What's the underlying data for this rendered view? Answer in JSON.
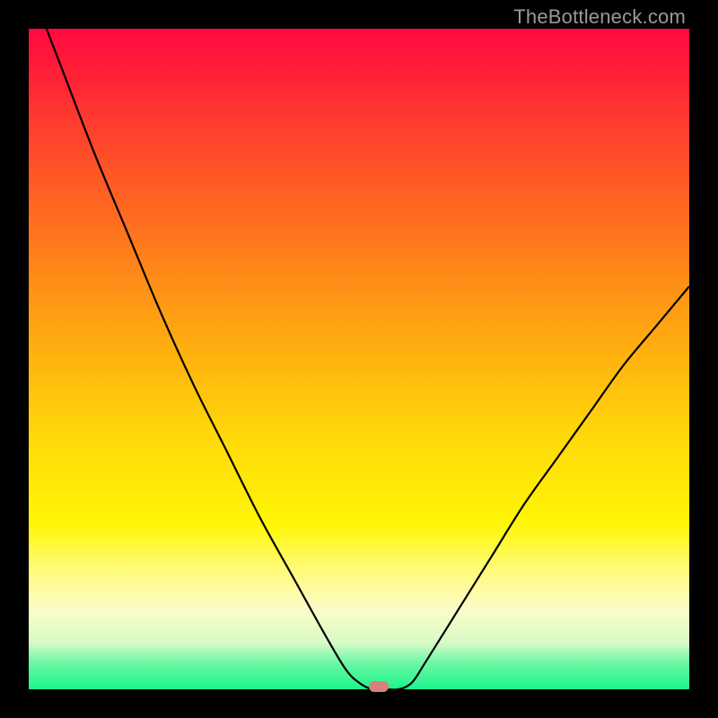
{
  "watermark": "TheBottleneck.com",
  "colors": {
    "frame": "#000000",
    "curve_stroke": "#000000",
    "marker": "#d88176",
    "gradient_stops": [
      {
        "offset": 0.0,
        "color": "#ff0a40"
      },
      {
        "offset": 0.05,
        "color": "#ff1938"
      },
      {
        "offset": 0.15,
        "color": "#ff3f2d"
      },
      {
        "offset": 0.28,
        "color": "#ff6a20"
      },
      {
        "offset": 0.45,
        "color": "#ffa412"
      },
      {
        "offset": 0.62,
        "color": "#ffd909"
      },
      {
        "offset": 0.75,
        "color": "#fff606"
      },
      {
        "offset": 0.82,
        "color": "#fffb7c"
      },
      {
        "offset": 0.88,
        "color": "#fcfcc8"
      },
      {
        "offset": 0.93,
        "color": "#d7fbc5"
      },
      {
        "offset": 0.96,
        "color": "#6bf7a4"
      },
      {
        "offset": 1.0,
        "color": "#1df58c"
      }
    ]
  },
  "chart_data": {
    "type": "line",
    "title": "",
    "xlabel": "",
    "ylabel": "",
    "xlim": [
      0,
      100
    ],
    "ylim": [
      0,
      100
    ],
    "grid": false,
    "series": [
      {
        "name": "bottleneck-curve",
        "x": [
          0,
          5,
          10,
          15,
          20,
          25,
          30,
          35,
          40,
          45,
          48,
          50,
          52,
          54,
          56,
          58,
          60,
          65,
          70,
          75,
          80,
          85,
          90,
          95,
          100
        ],
        "y": [
          107,
          94,
          81,
          69,
          57,
          46,
          36,
          26,
          17,
          8,
          3,
          1,
          0,
          0,
          0,
          1,
          4,
          12,
          20,
          28,
          35,
          42,
          49,
          55,
          61
        ]
      }
    ],
    "marker": {
      "x": 53,
      "y": 0
    },
    "legend": false
  }
}
